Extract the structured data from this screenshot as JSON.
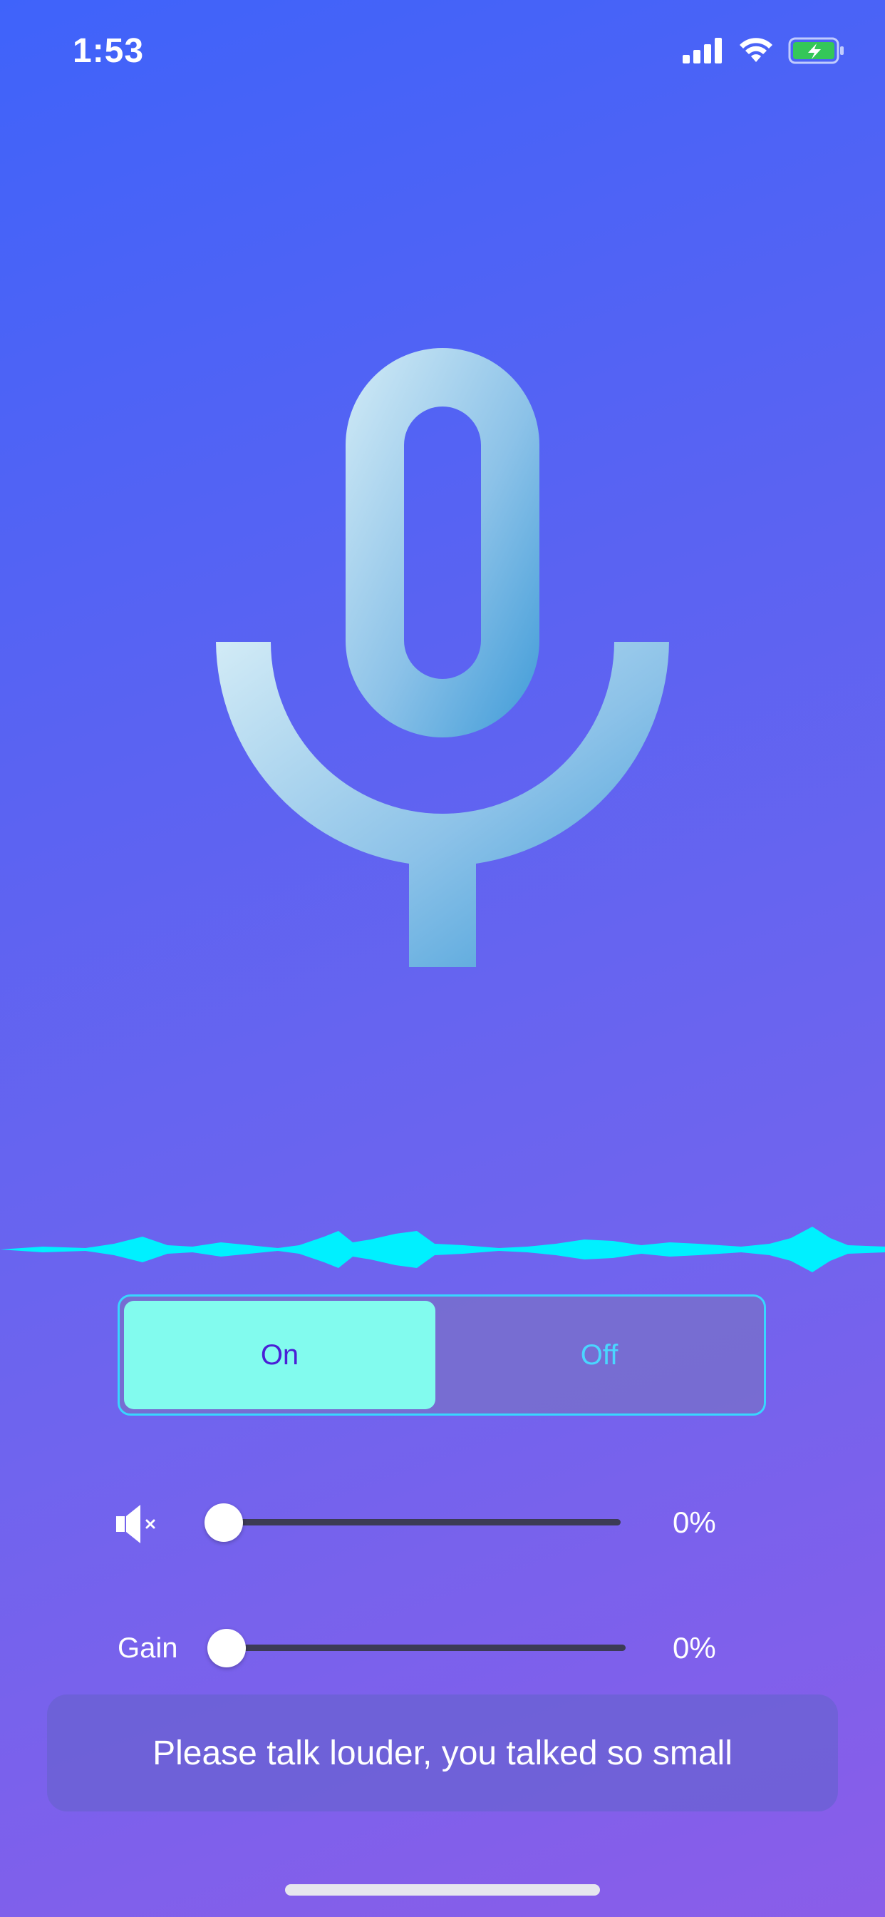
{
  "status_bar": {
    "time": "1:53",
    "icons": [
      "cellular-signal-icon",
      "wifi-icon",
      "battery-charging-icon"
    ],
    "battery_color": "#34c759"
  },
  "microphone": {
    "icon": "microphone-icon",
    "gradient_start": "#c6e3f4",
    "gradient_end": "#4aa3dc"
  },
  "waveform": {
    "icon": "audio-waveform",
    "color": "#00f0ff"
  },
  "toggle": {
    "on_label": "On",
    "off_label": "Off",
    "selected": "On",
    "selected_bg": "#82fbee",
    "on_text_color": "#4a1fd6",
    "off_text_color": "#4ad6ff"
  },
  "volume": {
    "icon": "speaker-muted-icon",
    "value_text": "0%",
    "value": 0
  },
  "gain": {
    "label": "Gain",
    "value_text": "0%",
    "value": 0
  },
  "message": {
    "text": "Please talk louder, you talked so small"
  },
  "colors": {
    "background_top": "#3f63fa",
    "background_bottom": "#8a5de9",
    "track": "#3c3b55"
  }
}
